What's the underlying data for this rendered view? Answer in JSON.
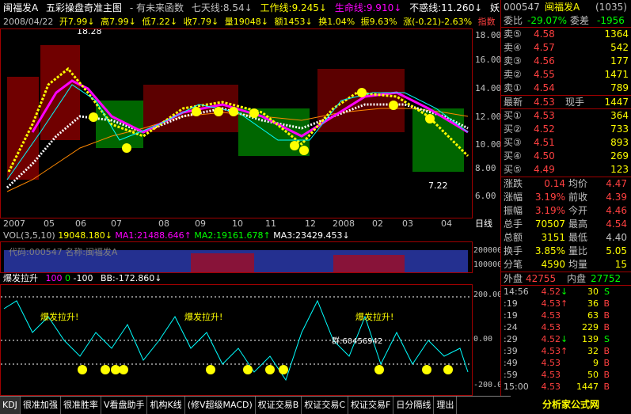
{
  "header": {
    "stock_name": "闽福发A",
    "title": "五彩操盘奇准主图",
    "subtitle": "- 有未来函数",
    "seven_day": "七天线:8.54↓",
    "work_line": "工作线:9.245↓",
    "life_line": "生命线:9.910↓",
    "not_miss": "不惑线:11.260↓",
    "corner": "妖1"
  },
  "ohlc": {
    "date": "2008/04/22",
    "open": "开7.99↓",
    "high": "高7.99↓",
    "low": "低7.22↓",
    "close": "收7.79↓",
    "vol": "量19048↓",
    "amount": "额1453↓",
    "turnover": "换1.04%",
    "amp": "振9.63%",
    "change": "涨(-0.21)-2.63%",
    "indicator": "指数"
  },
  "price_axis": [
    "18.00",
    "16.00",
    "14.00",
    "12.00",
    "10.00",
    "8.00",
    "6.00"
  ],
  "price_annotations": {
    "high": "18.28",
    "low": "7.22"
  },
  "date_axis": [
    "2007",
    "05",
    "06",
    "07",
    "08",
    "09",
    "10",
    "11",
    "12",
    "2008",
    "02",
    "03",
    "04"
  ],
  "date_axis_right": "日线",
  "volume": {
    "header": "VOL(3,5,10)",
    "v": "19048.180↓",
    "ma1": "MA1:21488.646↑",
    "ma2": "MA2:19161.678↑",
    "ma3": "MA3:23429.453↓",
    "axis": [
      "200000",
      "100000"
    ],
    "watermark": "代码:000547 名称:闽福发A"
  },
  "indicator": {
    "name": "爆发拉升",
    "p1": "100",
    "p2": "0",
    "p3": "-100",
    "bb": "BB:-172.860↓",
    "axis": [
      "200.00",
      "0.00",
      "-200.00"
    ],
    "labels": [
      "爆发拉升!",
      "爆发拉升!",
      "爆发拉升!",
      "爆发拉升!"
    ],
    "note": "群:60456942"
  },
  "quote": {
    "code": "000547",
    "name": "闽福发A",
    "num": "(1035)",
    "weibi_label": "委比",
    "weibi": "-29.07%",
    "weicha_label": "委差",
    "weicha": "-1956",
    "sell": [
      {
        "label": "卖⑤",
        "price": "4.58",
        "vol": "1364"
      },
      {
        "label": "卖④",
        "price": "4.57",
        "vol": "542"
      },
      {
        "label": "卖③",
        "price": "4.56",
        "vol": "177"
      },
      {
        "label": "卖②",
        "price": "4.55",
        "vol": "1471"
      },
      {
        "label": "卖①",
        "price": "4.54",
        "vol": "789"
      }
    ],
    "latest_label": "最新",
    "latest": "4.53",
    "now_label": "现手",
    "now": "1447",
    "buy": [
      {
        "label": "买①",
        "price": "4.53",
        "vol": "364"
      },
      {
        "label": "买②",
        "price": "4.52",
        "vol": "733"
      },
      {
        "label": "买③",
        "price": "4.51",
        "vol": "893"
      },
      {
        "label": "买④",
        "price": "4.50",
        "vol": "269"
      },
      {
        "label": "买⑤",
        "price": "4.49",
        "vol": "123"
      }
    ],
    "stats": [
      {
        "l1": "涨跌",
        "v1": "0.14",
        "l2": "均价",
        "v2": "4.47"
      },
      {
        "l1": "涨幅",
        "v1": "3.19%",
        "l2": "前收",
        "v2": "4.39"
      },
      {
        "l1": "振幅",
        "v1": "3.19%",
        "l2": "今开",
        "v2": "4.46"
      },
      {
        "l1": "总手",
        "v1": "70507",
        "l2": "最高",
        "v2": "4.54"
      },
      {
        "l1": "总额",
        "v1": "3151",
        "l2": "最低",
        "v2": "4.40"
      },
      {
        "l1": "换手",
        "v1": "3.85%",
        "l2": "量比",
        "v2": "5.05"
      },
      {
        "l1": "分笔",
        "v1": "4590",
        "l2": "均量",
        "v2": "15"
      }
    ],
    "outer_label": "外盘",
    "outer": "42755",
    "inner_label": "内盘",
    "inner": "27752",
    "ticks": [
      {
        "t": "14:56",
        "p": "4.52",
        "a": "↓",
        "v": "30",
        "s": "S"
      },
      {
        "t": ":19",
        "p": "4.53",
        "a": "↑",
        "v": "36",
        "s": "B"
      },
      {
        "t": ":19",
        "p": "4.53",
        "a": "",
        "v": "63",
        "s": "B"
      },
      {
        "t": ":24",
        "p": "4.53",
        "a": "",
        "v": "229",
        "s": "B"
      },
      {
        "t": ":29",
        "p": "4.52",
        "a": "↓",
        "v": "139",
        "s": "S"
      },
      {
        "t": ":39",
        "p": "4.53",
        "a": "↑",
        "v": "32",
        "s": "B"
      },
      {
        "t": ":49",
        "p": "4.53",
        "a": "",
        "v": "9",
        "s": "B"
      },
      {
        "t": ":59",
        "p": "4.53",
        "a": "",
        "v": "50",
        "s": "B"
      },
      {
        "t": "15:00",
        "p": "4.53",
        "a": "",
        "v": "1447",
        "s": "B"
      }
    ]
  },
  "tabs": [
    "KDJ",
    "很准加强",
    "很准胜率",
    "V看盘助手",
    "机构K线",
    "(修V超级MACD)",
    "权证交易B",
    "权证交易C",
    "权证交易F",
    "日分隔线",
    "理出"
  ],
  "watermark_site": "分析家公式网 www.88gs.com"
}
